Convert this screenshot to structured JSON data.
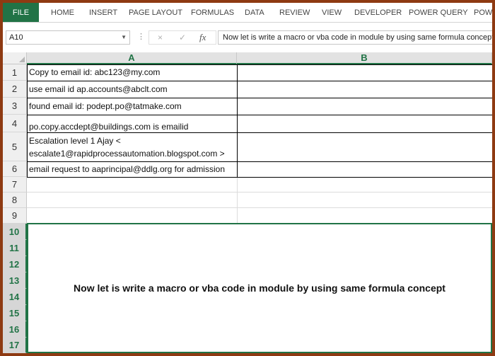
{
  "ribbon": {
    "tabs": [
      "FILE",
      "HOME",
      "INSERT",
      "PAGE LAYOUT",
      "FORMULAS",
      "DATA",
      "REVIEW",
      "VIEW",
      "DEVELOPER",
      "POWER QUERY",
      "POWE"
    ]
  },
  "formula_bar": {
    "name_box": "A10",
    "fx_label": "fx",
    "cancel_icon": "×",
    "enter_icon": "✓",
    "content": "Now let is write a macro or vba code in module by using same formula concept"
  },
  "columns": [
    "A",
    "B"
  ],
  "rows": [
    "1",
    "2",
    "3",
    "4",
    "5",
    "6",
    "7",
    "8",
    "9",
    "10",
    "11",
    "12",
    "13",
    "14",
    "15",
    "16",
    "17"
  ],
  "cells": {
    "A1": "Copy to email id: abc123@my.com",
    "A2": "use email id ap.accounts@abclt.com",
    "A3": "found email id: podept.po@tatmake.com",
    "A4": "po.copy.accdept@buildings.com is emailid",
    "A5": "Escalation level 1 Ajay  < escalate1@rapidprocessautomation.blogspot.com >",
    "A6": "email request to aaprincipal@ddlg.org for admission"
  },
  "merged_cell_text": "Now let is write a macro or vba code in module by using same formula concept",
  "colors": {
    "excel_green": "#217346",
    "frame": "#8e3a12"
  }
}
